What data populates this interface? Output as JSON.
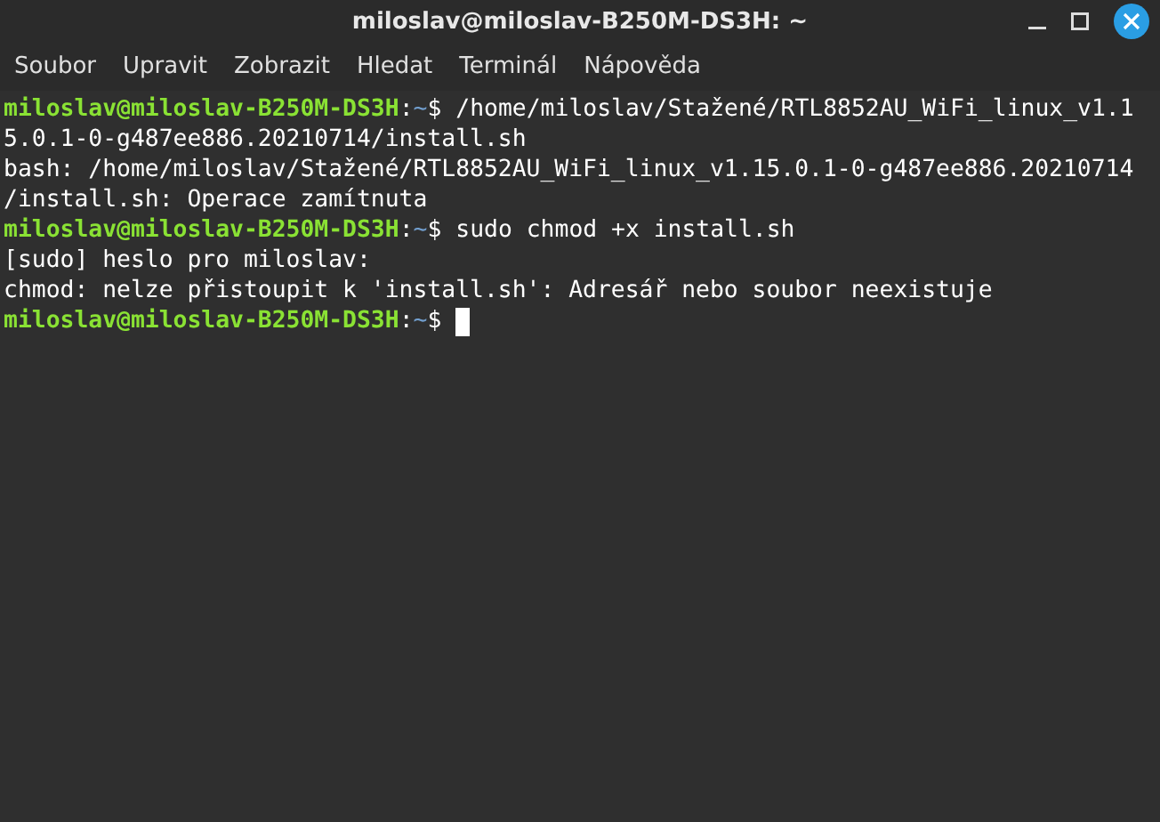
{
  "window": {
    "title": "miloslav@miloslav-B250M-DS3H: ~"
  },
  "menu": [
    "Soubor",
    "Upravit",
    "Zobrazit",
    "Hledat",
    "Terminál",
    "Nápověda"
  ],
  "terminal": {
    "lines": [
      {
        "kind": "prompt",
        "user": "miloslav@miloslav-B250M-DS3H",
        "colon": ":",
        "path": "~",
        "symbol": "$",
        "command": "/home/miloslav/Stažené/RTL8852AU_WiFi_linux_v1.1"
      },
      {
        "kind": "output",
        "text": "5.0.1-0-g487ee886.20210714/install.sh"
      },
      {
        "kind": "output",
        "text": "bash: /home/miloslav/Stažené/RTL8852AU_WiFi_linux_v1.15.0.1-0-g487ee886.20210714"
      },
      {
        "kind": "output",
        "text": "/install.sh: Operace zamítnuta"
      },
      {
        "kind": "prompt",
        "user": "miloslav@miloslav-B250M-DS3H",
        "colon": ":",
        "path": "~",
        "symbol": "$",
        "command": "sudo chmod +x install.sh"
      },
      {
        "kind": "output",
        "text": "[sudo] heslo pro miloslav:"
      },
      {
        "kind": "output",
        "text": "chmod: nelze přistoupit k 'install.sh': Adresář nebo soubor neexistuje"
      },
      {
        "kind": "prompt",
        "user": "miloslav@miloslav-B250M-DS3H",
        "colon": ":",
        "path": "~",
        "symbol": "$",
        "cursor": true
      }
    ]
  }
}
